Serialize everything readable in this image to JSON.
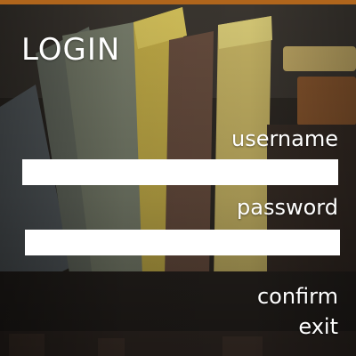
{
  "title": "LOGIN",
  "username": {
    "label": "username",
    "value": ""
  },
  "password": {
    "label": "password",
    "value": ""
  },
  "actions": {
    "confirm_label": "confirm",
    "exit_label": "exit"
  },
  "colors": {
    "accent_bar": "#b0651c",
    "text": "#ffffff",
    "field_background": "#ffffff"
  }
}
